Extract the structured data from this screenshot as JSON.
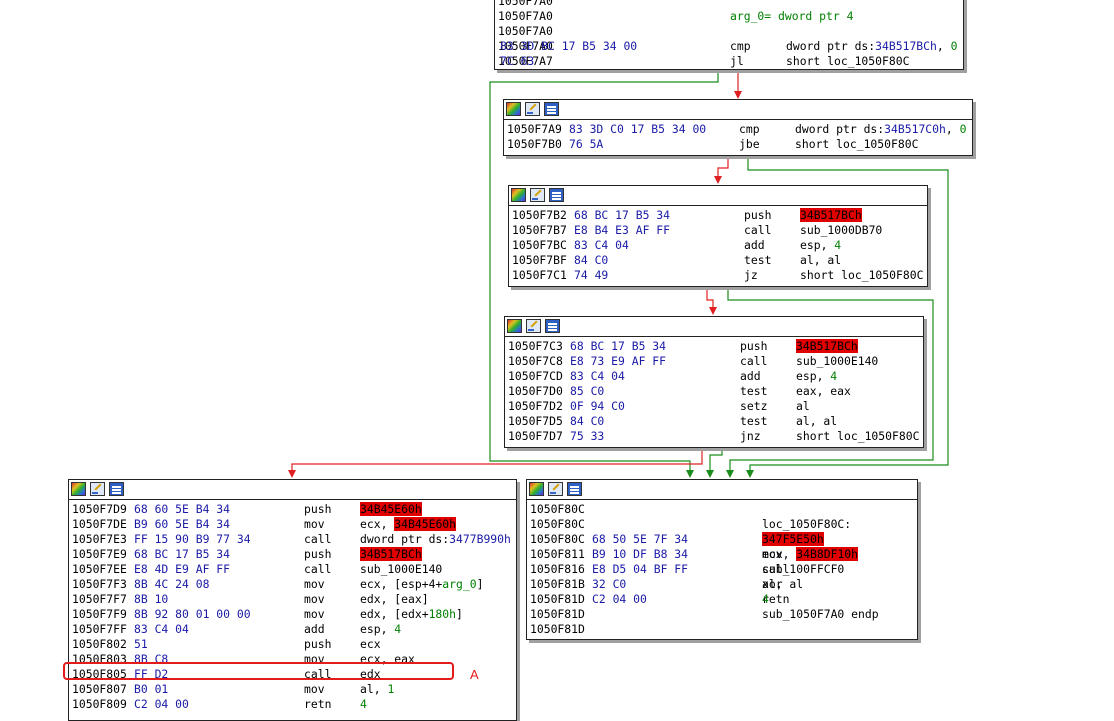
{
  "colors": {
    "edge_true": "#1a8c1a",
    "edge_false": "#e02020",
    "highlight": "#e00000",
    "marker": "#e31b1b",
    "bytes": "#1a1aa6",
    "number": "#008000"
  },
  "blocks": [
    {
      "id": "block-1050f7a0",
      "header": false,
      "rows": [
        {
          "addr": "1050F7A0",
          "bytes": "",
          "mn": "",
          "ops": []
        },
        {
          "addr": "1050F7A0",
          "bytes": "",
          "mn": "",
          "ops": [
            {
              "t": "arg_0= dword ptr  ",
              "c": "num"
            },
            {
              "t": "4",
              "c": "num"
            }
          ]
        },
        {
          "addr": "1050F7A0",
          "bytes": "",
          "mn": "",
          "ops": []
        },
        {
          "addr": "1050F7A0",
          "bytes": "83 3D BC 17 B5 34 00",
          "mn": "cmp",
          "ops": [
            {
              "t": "dword ptr ds:"
            },
            {
              "t": "34B517BCh",
              "c": "bytes"
            },
            {
              "t": ", "
            },
            {
              "t": "0",
              "c": "num"
            }
          ]
        },
        {
          "addr": "1050F7A7",
          "bytes": "7C 63",
          "mn": "jl",
          "ops": [
            {
              "t": "short loc_1050F80C"
            }
          ]
        }
      ]
    },
    {
      "id": "block-1050f7a9",
      "header": true,
      "rows": [
        {
          "addr": "1050F7A9",
          "bytes": "83 3D C0 17 B5 34 00",
          "mn": "cmp",
          "ops": [
            {
              "t": "dword ptr ds:"
            },
            {
              "t": "34B517C0h",
              "c": "bytes"
            },
            {
              "t": ", "
            },
            {
              "t": "0",
              "c": "num"
            }
          ]
        },
        {
          "addr": "1050F7B0",
          "bytes": "76 5A",
          "mn": "jbe",
          "ops": [
            {
              "t": "short loc_1050F80C"
            }
          ]
        }
      ]
    },
    {
      "id": "block-1050f7b2",
      "header": true,
      "rows": [
        {
          "addr": "1050F7B2",
          "bytes": "68 BC 17 B5 34",
          "mn": "push",
          "ops": [
            {
              "t": "34B517BCh",
              "c": "hl"
            }
          ]
        },
        {
          "addr": "1050F7B7",
          "bytes": "E8 B4 E3 AF FF",
          "mn": "call",
          "ops": [
            {
              "t": "sub_1000DB70"
            }
          ]
        },
        {
          "addr": "1050F7BC",
          "bytes": "83 C4 04",
          "mn": "add",
          "ops": [
            {
              "t": "esp, "
            },
            {
              "t": "4",
              "c": "num"
            }
          ]
        },
        {
          "addr": "1050F7BF",
          "bytes": "84 C0",
          "mn": "test",
          "ops": [
            {
              "t": "al, al"
            }
          ]
        },
        {
          "addr": "1050F7C1",
          "bytes": "74 49",
          "mn": "jz",
          "ops": [
            {
              "t": "short loc_1050F80C"
            }
          ]
        }
      ]
    },
    {
      "id": "block-1050f7c3",
      "header": true,
      "rows": [
        {
          "addr": "1050F7C3",
          "bytes": "68 BC 17 B5 34",
          "mn": "push",
          "ops": [
            {
              "t": "34B517BCh",
              "c": "hl"
            }
          ]
        },
        {
          "addr": "1050F7C8",
          "bytes": "E8 73 E9 AF FF",
          "mn": "call",
          "ops": [
            {
              "t": "sub_1000E140"
            }
          ]
        },
        {
          "addr": "1050F7CD",
          "bytes": "83 C4 04",
          "mn": "add",
          "ops": [
            {
              "t": "esp, "
            },
            {
              "t": "4",
              "c": "num"
            }
          ]
        },
        {
          "addr": "1050F7D0",
          "bytes": "85 C0",
          "mn": "test",
          "ops": [
            {
              "t": "eax, eax"
            }
          ]
        },
        {
          "addr": "1050F7D2",
          "bytes": "0F 94 C0",
          "mn": "setz",
          "ops": [
            {
              "t": "al"
            }
          ]
        },
        {
          "addr": "1050F7D5",
          "bytes": "84 C0",
          "mn": "test",
          "ops": [
            {
              "t": "al, al"
            }
          ]
        },
        {
          "addr": "1050F7D7",
          "bytes": "75 33",
          "mn": "jnz",
          "ops": [
            {
              "t": "short loc_1050F80C"
            }
          ]
        }
      ]
    },
    {
      "id": "block-1050f7d9",
      "header": true,
      "rows": [
        {
          "addr": "1050F7D9",
          "bytes": "68 60 5E B4 34",
          "mn": "push",
          "ops": [
            {
              "t": "34B45E60h",
              "c": "hl"
            }
          ]
        },
        {
          "addr": "1050F7DE",
          "bytes": "B9 60 5E B4 34",
          "mn": "mov",
          "ops": [
            {
              "t": "ecx, "
            },
            {
              "t": "34B45E60h",
              "c": "hl"
            }
          ]
        },
        {
          "addr": "1050F7E3",
          "bytes": "FF 15 90 B9 77 34",
          "mn": "call",
          "ops": [
            {
              "t": "dword ptr ds:"
            },
            {
              "t": "3477B990h",
              "c": "bytes"
            }
          ]
        },
        {
          "addr": "1050F7E9",
          "bytes": "68 BC 17 B5 34",
          "mn": "push",
          "ops": [
            {
              "t": "34B517BCh",
              "c": "hl"
            }
          ]
        },
        {
          "addr": "1050F7EE",
          "bytes": "E8 4D E9 AF FF",
          "mn": "call",
          "ops": [
            {
              "t": "sub_1000E140"
            }
          ]
        },
        {
          "addr": "1050F7F3",
          "bytes": "8B 4C 24 08",
          "mn": "mov",
          "ops": [
            {
              "t": "ecx, [esp+4+"
            },
            {
              "t": "arg_0",
              "c": "num"
            },
            {
              "t": "]"
            }
          ]
        },
        {
          "addr": "1050F7F7",
          "bytes": "8B 10",
          "mn": "mov",
          "ops": [
            {
              "t": "edx, [eax]"
            }
          ]
        },
        {
          "addr": "1050F7F9",
          "bytes": "8B 92 80 01 00 00",
          "mn": "mov",
          "ops": [
            {
              "t": "edx, [edx+"
            },
            {
              "t": "180h",
              "c": "num"
            },
            {
              "t": "]"
            }
          ]
        },
        {
          "addr": "1050F7FF",
          "bytes": "83 C4 04",
          "mn": "add",
          "ops": [
            {
              "t": "esp, "
            },
            {
              "t": "4",
              "c": "num"
            }
          ]
        },
        {
          "addr": "1050F802",
          "bytes": "51",
          "mn": "push",
          "ops": [
            {
              "t": "ecx"
            }
          ]
        },
        {
          "addr": "1050F803",
          "bytes": "8B C8",
          "mn": "mov",
          "ops": [
            {
              "t": "ecx, eax"
            }
          ]
        },
        {
          "addr": "1050F805",
          "bytes": "FF D2",
          "mn": "call",
          "ops": [
            {
              "t": "edx"
            }
          ]
        },
        {
          "addr": "1050F807",
          "bytes": "B0 01",
          "mn": "mov",
          "ops": [
            {
              "t": "al, "
            },
            {
              "t": "1",
              "c": "num"
            }
          ]
        },
        {
          "addr": "1050F809",
          "bytes": "C2 04 00",
          "mn": "retn",
          "ops": [
            {
              "t": "4",
              "c": "num"
            }
          ]
        }
      ]
    },
    {
      "id": "block-1050f80c",
      "header": true,
      "rows": [
        {
          "addr": "1050F80C",
          "bytes": "",
          "mn": "",
          "ops": []
        },
        {
          "addr": "1050F80C",
          "bytes": "",
          "mn": "",
          "ops": [
            {
              "t": "loc_1050F80C:"
            }
          ]
        },
        {
          "addr": "1050F80C",
          "bytes": "68 50 5E 7F 34",
          "mn": "push",
          "ops": [
            {
              "t": "347F5E50h",
              "c": "hl"
            }
          ]
        },
        {
          "addr": "1050F811",
          "bytes": "B9 10 DF B8 34",
          "mn": "mov",
          "ops": [
            {
              "t": "ecx, "
            },
            {
              "t": "34B8DF10h",
              "c": "hl"
            }
          ]
        },
        {
          "addr": "1050F816",
          "bytes": "E8 D5 04 BF FF",
          "mn": "call",
          "ops": [
            {
              "t": "sub_100FFCF0"
            }
          ]
        },
        {
          "addr": "1050F81B",
          "bytes": "32 C0",
          "mn": "xor",
          "ops": [
            {
              "t": "al, al"
            }
          ]
        },
        {
          "addr": "1050F81D",
          "bytes": "C2 04 00",
          "mn": "retn",
          "ops": [
            {
              "t": "4",
              "c": "num"
            }
          ]
        },
        {
          "addr": "1050F81D",
          "bytes": "",
          "mn": "",
          "ops": [
            {
              "t": "sub_1050F7A0 endp"
            }
          ]
        },
        {
          "addr": "1050F81D",
          "bytes": "",
          "mn": "",
          "ops": []
        }
      ]
    }
  ],
  "annotation": {
    "label": "A"
  }
}
